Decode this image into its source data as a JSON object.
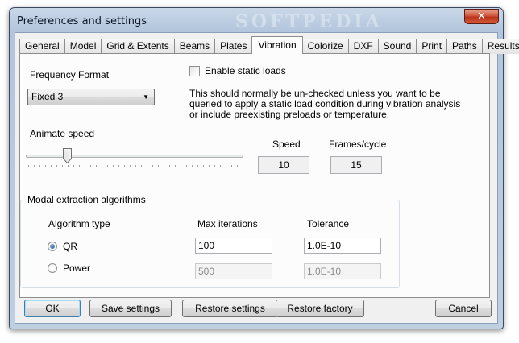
{
  "window": {
    "title": "Preferences and settings",
    "watermark": "SOFTPEDIA",
    "close_glyph": "✕"
  },
  "tabs": [
    {
      "label": "General"
    },
    {
      "label": "Model"
    },
    {
      "label": "Grid & Extents"
    },
    {
      "label": "Beams"
    },
    {
      "label": "Plates"
    },
    {
      "label": "Vibration",
      "active": true
    },
    {
      "label": "Colorize"
    },
    {
      "label": "DXF"
    },
    {
      "label": "Sound"
    },
    {
      "label": "Print"
    },
    {
      "label": "Paths"
    },
    {
      "label": "Results"
    }
  ],
  "frequency": {
    "label": "Frequency Format",
    "selected": "Fixed 3"
  },
  "static_loads": {
    "label": "Enable static loads",
    "checked": false,
    "description": "This should normally be un-checked unless you want to be queried to apply a static load condition during vibration analysis or include preexisting preloads or temperature."
  },
  "animate": {
    "label": "Animate speed",
    "speed_label": "Speed",
    "speed_value": "10",
    "frames_label": "Frames/cycle",
    "frames_value": "15"
  },
  "modal": {
    "title": "Modal extraction algorithms",
    "algorithm_header": "Algorithm type",
    "max_iter_header": "Max iterations",
    "tolerance_header": "Tolerance",
    "options": [
      {
        "label": "QR",
        "selected": true,
        "max_iterations": "100",
        "tolerance": "1.0E-10"
      },
      {
        "label": "Power",
        "selected": false,
        "max_iterations": "500",
        "tolerance": "1.0E-10"
      }
    ]
  },
  "buttons": {
    "ok": "OK",
    "save": "Save settings",
    "restore": "Restore settings",
    "restore_factory": "Restore factory",
    "cancel": "Cancel"
  },
  "colors": {
    "title_bar": "#b2c5dc",
    "close_button": "#c9462a",
    "panel": "#fcfcfc",
    "default_button_border": "#3c7fb1"
  }
}
